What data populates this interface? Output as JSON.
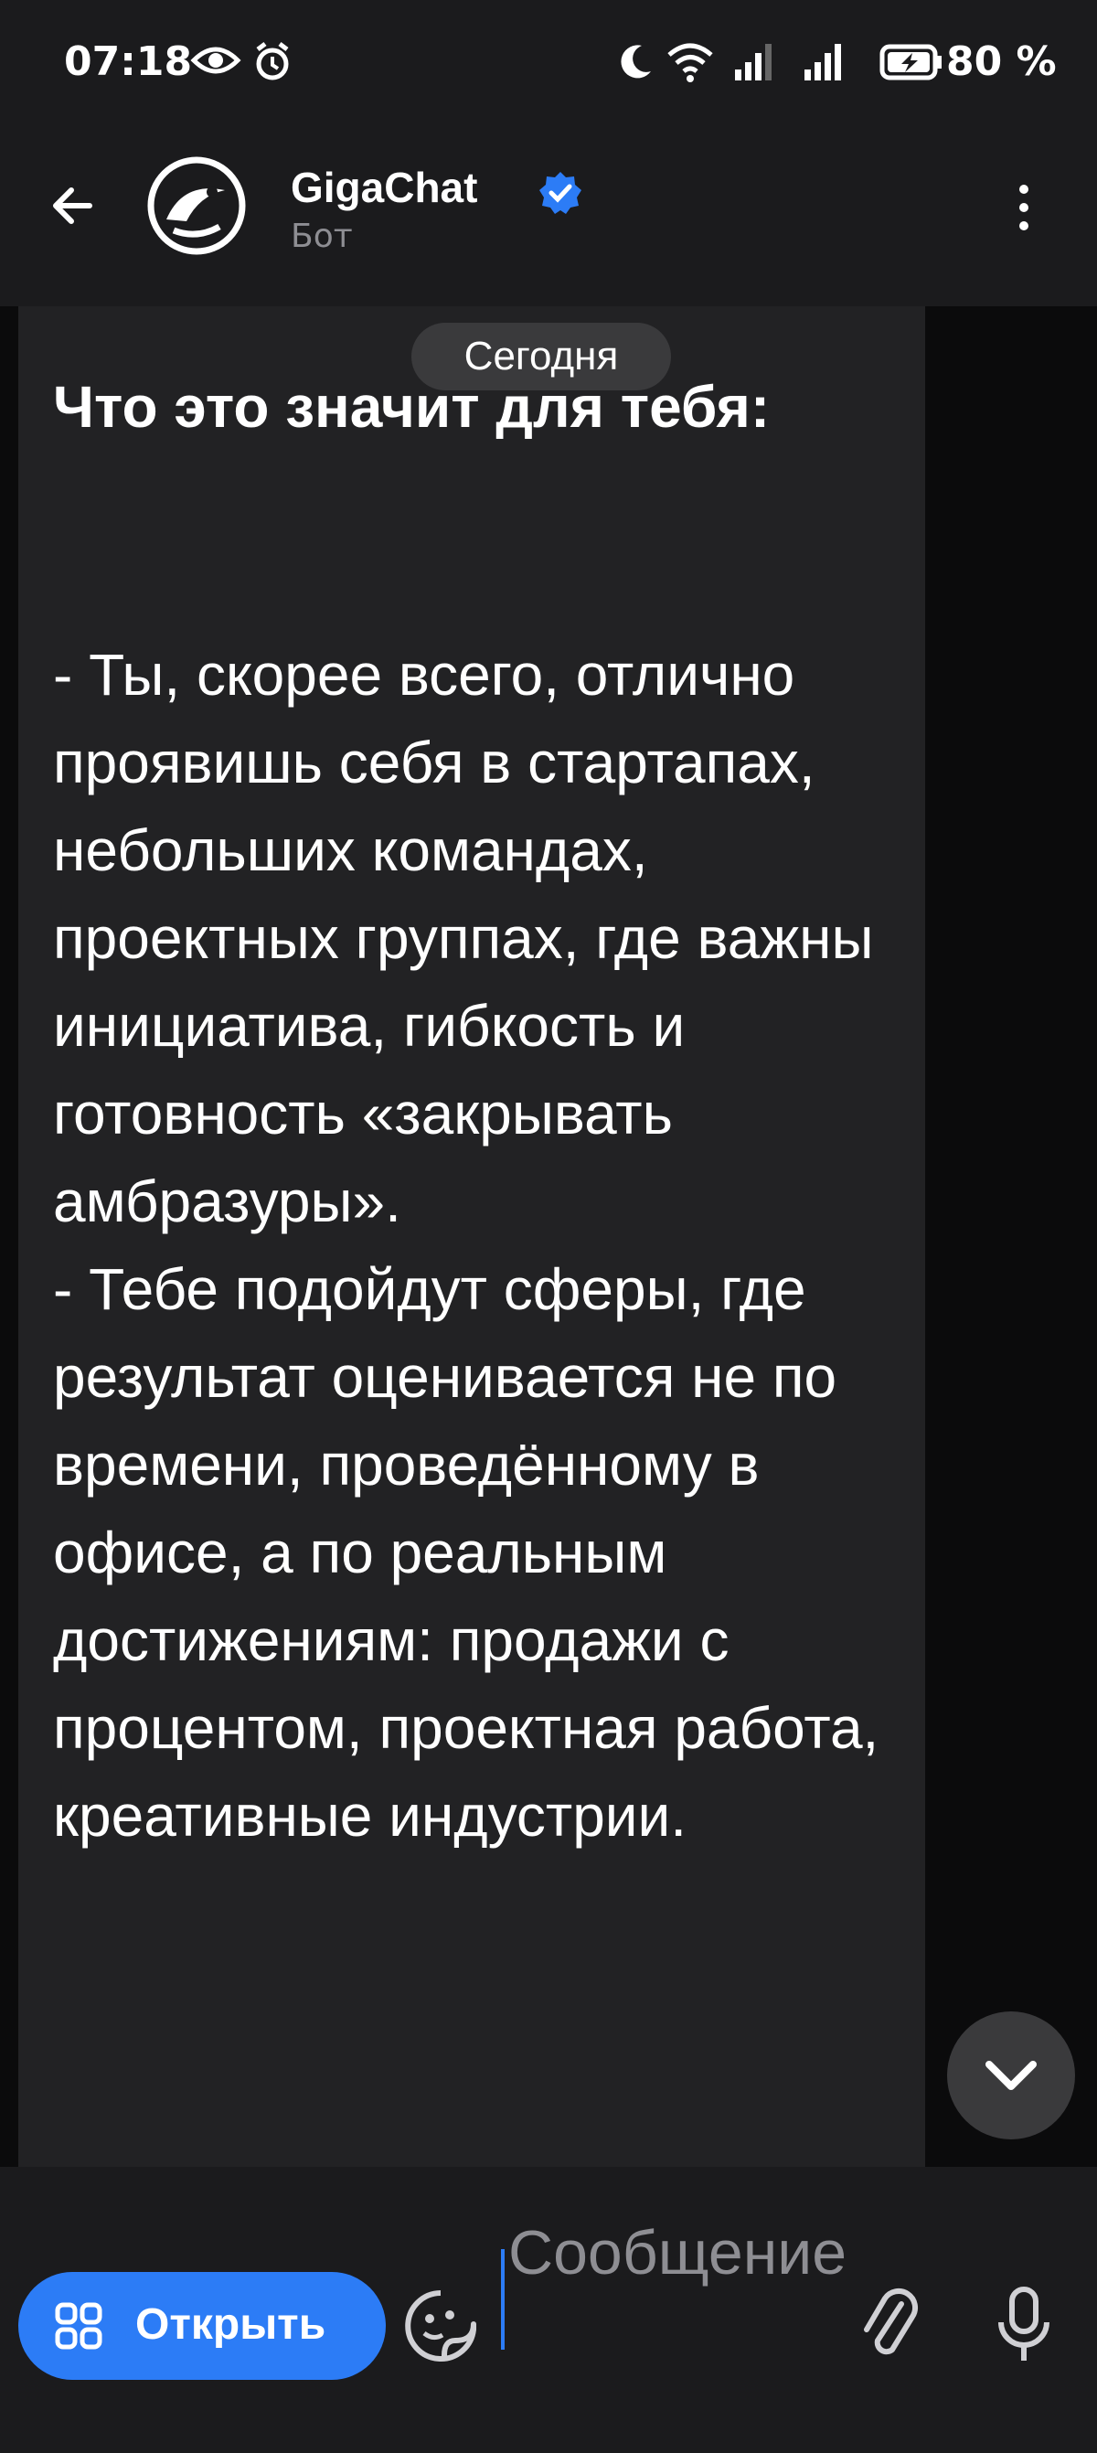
{
  "status_bar": {
    "time": "07:18",
    "battery": "80 %"
  },
  "header": {
    "title": "GigaChat",
    "subtitle": "Бот"
  },
  "chat": {
    "date_label": "Сегодня",
    "message_heading": "Что это значит для тебя:",
    "message_body": "- Ты, скорее всего, отлично проявишь себя в стартапах, небольших командах, проектных группах, где важны инициатива, гибкость и готовность «закрывать амбразуры».\n- Тебе подойдут сферы, где результат оценивается не по времени, проведённому в офисе, а по реальным достижениям: продажи с процентом, проектная работа, креативные индустрии."
  },
  "input_bar": {
    "open_button_label": "Открыть",
    "message_placeholder": "Сообщение"
  },
  "colors": {
    "accent": "#2c7cf6",
    "background": "#0b0b0c",
    "bubble": "#222224",
    "bar": "#1b1b1d",
    "muted": "#8e8e93"
  },
  "icons": [
    "eye-icon",
    "alarm-icon",
    "moon-icon",
    "wifi-icon",
    "signal-icon",
    "battery-icon",
    "back-arrow-icon",
    "gigachat-avatar-icon",
    "verified-icon",
    "more-vert-icon",
    "chevron-down-icon",
    "apps-icon",
    "sticker-icon",
    "paperclip-icon",
    "microphone-icon"
  ]
}
